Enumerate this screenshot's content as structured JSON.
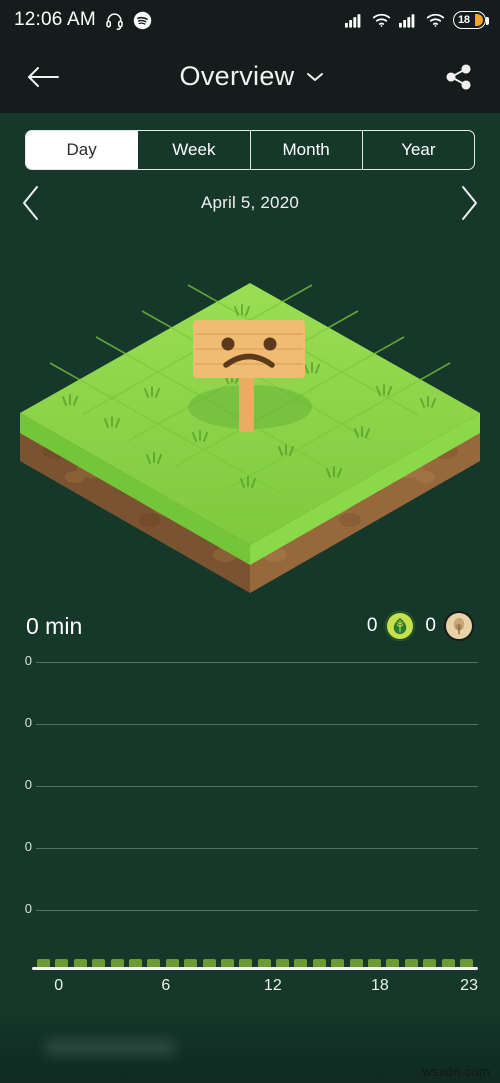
{
  "status_bar": {
    "time": "12:06 AM",
    "icons": [
      "headphones-icon",
      "spotify-icon",
      "signal-icon",
      "wifi-icon",
      "signal-icon-2",
      "wifi-icon-2"
    ],
    "battery_level": "18"
  },
  "header": {
    "title": "Overview",
    "back_icon": "arrow-left-icon",
    "dropdown_icon": "chevron-down-icon",
    "share_icon": "share-icon"
  },
  "segmented_control": {
    "options": [
      {
        "label": "Day",
        "active": true
      },
      {
        "label": "Week",
        "active": false
      },
      {
        "label": "Month",
        "active": false
      },
      {
        "label": "Year",
        "active": false
      }
    ]
  },
  "date_nav": {
    "prev_icon": "chevron-left-icon",
    "next_icon": "chevron-right-icon",
    "date": "April 5, 2020"
  },
  "plot_illustration": {
    "name": "isometric-grass-plot",
    "sign_face": "sad-face",
    "grass_color": "#8ed64a",
    "grass_color_dark": "#6fbf3a",
    "soil_color": "#8b6239",
    "sign_color": "#f0b969"
  },
  "summary": {
    "focus_time": "0 min",
    "leaf_count": "0",
    "leaf_icon": "leaf-badge-icon",
    "tree_count": "0",
    "tree_icon": "tree-badge-icon"
  },
  "chart_data": {
    "type": "bar",
    "title": "",
    "xlabel": "",
    "ylabel": "",
    "categories": [
      "0",
      "1",
      "2",
      "3",
      "4",
      "5",
      "6",
      "7",
      "8",
      "9",
      "10",
      "11",
      "12",
      "13",
      "14",
      "15",
      "16",
      "17",
      "18",
      "19",
      "20",
      "21",
      "22",
      "23"
    ],
    "values": [
      0,
      0,
      0,
      0,
      0,
      0,
      0,
      0,
      0,
      0,
      0,
      0,
      0,
      0,
      0,
      0,
      0,
      0,
      0,
      0,
      0,
      0,
      0,
      0
    ],
    "x_tick_labels": [
      "0",
      "6",
      "12",
      "18",
      "23"
    ],
    "x_tick_positions": [
      0,
      6,
      12,
      18,
      23
    ],
    "y_tick_labels": [
      "0",
      "0",
      "0",
      "0",
      "0"
    ],
    "ylim": [
      0,
      0
    ],
    "grid": true,
    "legend": "none",
    "bar_color": "#6d9b31",
    "axis_color": "#f3f3f3"
  },
  "watermark": {
    "text": "wsxdn.com"
  },
  "theme": {
    "background": "#16382a",
    "header_background": "#141d1b",
    "accent": "#c6e04e",
    "text": "#ffffff"
  }
}
